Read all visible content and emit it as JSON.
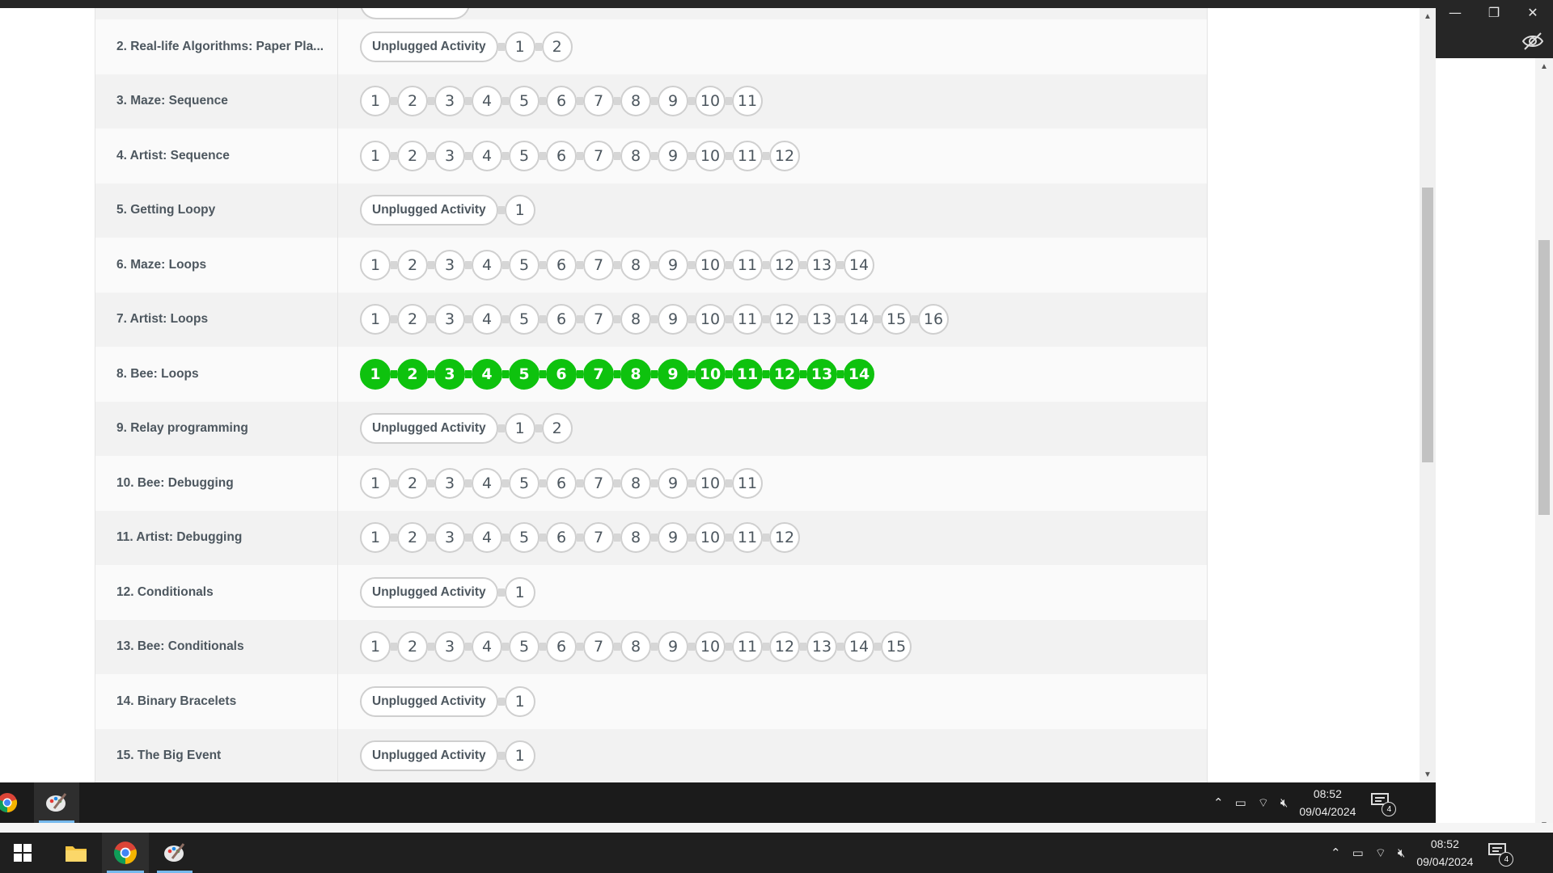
{
  "lessons": [
    {
      "name": "",
      "type": "pill-partial",
      "items": []
    },
    {
      "name": "2. Real-life Algorithms: Paper Pla...",
      "unplugged": "Unplugged Activity",
      "levels": [
        "1",
        "2"
      ],
      "done": false
    },
    {
      "name": "3. Maze: Sequence",
      "levels": [
        "1",
        "2",
        "3",
        "4",
        "5",
        "6",
        "7",
        "8",
        "9",
        "10",
        "11"
      ],
      "done": false
    },
    {
      "name": "4. Artist: Sequence",
      "levels": [
        "1",
        "2",
        "3",
        "4",
        "5",
        "6",
        "7",
        "8",
        "9",
        "10",
        "11",
        "12"
      ],
      "done": false
    },
    {
      "name": "5. Getting Loopy",
      "unplugged": "Unplugged Activity",
      "levels": [
        "1"
      ],
      "done": false
    },
    {
      "name": "6. Maze: Loops",
      "levels": [
        "1",
        "2",
        "3",
        "4",
        "5",
        "6",
        "7",
        "8",
        "9",
        "10",
        "11",
        "12",
        "13",
        "14"
      ],
      "done": false
    },
    {
      "name": "7. Artist: Loops",
      "levels": [
        "1",
        "2",
        "3",
        "4",
        "5",
        "6",
        "7",
        "8",
        "9",
        "10",
        "11",
        "12",
        "13",
        "14",
        "15",
        "16"
      ],
      "done": false
    },
    {
      "name": "8. Bee: Loops",
      "levels": [
        "1",
        "2",
        "3",
        "4",
        "5",
        "6",
        "7",
        "8",
        "9",
        "10",
        "11",
        "12",
        "13",
        "14"
      ],
      "done": true
    },
    {
      "name": "9. Relay programming",
      "unplugged": "Unplugged Activity",
      "levels": [
        "1",
        "2"
      ],
      "done": false
    },
    {
      "name": "10. Bee: Debugging",
      "levels": [
        "1",
        "2",
        "3",
        "4",
        "5",
        "6",
        "7",
        "8",
        "9",
        "10",
        "11"
      ],
      "done": false
    },
    {
      "name": "11. Artist: Debugging",
      "levels": [
        "1",
        "2",
        "3",
        "4",
        "5",
        "6",
        "7",
        "8",
        "9",
        "10",
        "11",
        "12"
      ],
      "done": false
    },
    {
      "name": "12. Conditionals",
      "unplugged": "Unplugged Activity",
      "levels": [
        "1"
      ],
      "done": false
    },
    {
      "name": "13. Bee: Conditionals",
      "levels": [
        "1",
        "2",
        "3",
        "4",
        "5",
        "6",
        "7",
        "8",
        "9",
        "10",
        "11",
        "12",
        "13",
        "14",
        "15"
      ],
      "done": false
    },
    {
      "name": "14. Binary Bracelets",
      "unplugged": "Unplugged Activity",
      "levels": [
        "1"
      ],
      "done": false
    },
    {
      "name": "15. The Big Event",
      "unplugged": "Unplugged Activity",
      "levels": [
        "1"
      ],
      "done": false
    }
  ],
  "colors": {
    "done": "#0ec20e",
    "border": "#cfcfcf",
    "text": "#4d575f"
  },
  "taskbar_inner": {
    "apps": [
      "chrome-icon",
      "paint-icon"
    ],
    "time": "08:52",
    "date": "09/04/2024",
    "notifications": "4"
  },
  "taskbar_outer": {
    "apps": [
      "windows-start-icon",
      "file-explorer-icon",
      "chrome-icon",
      "paint-icon"
    ],
    "time": "08:52",
    "date": "09/04/2024",
    "notifications": "4"
  },
  "window_controls": {
    "minimize": "—",
    "maximize": "❐",
    "close": "✕"
  }
}
